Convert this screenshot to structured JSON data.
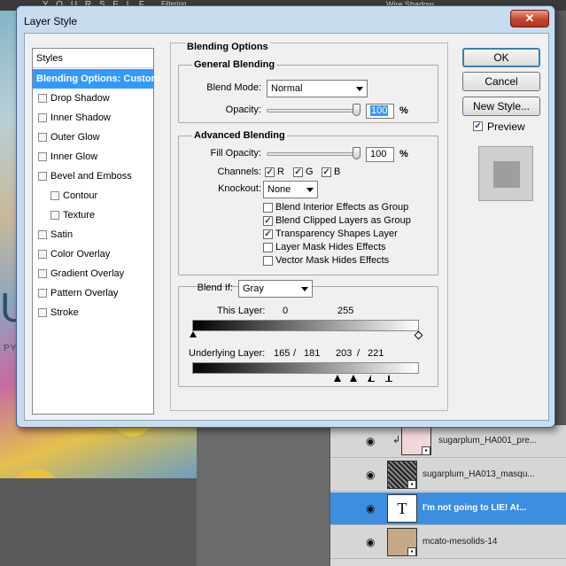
{
  "background": {
    "top_text": "Y O U R S E L F",
    "top_small": "Filtering ...",
    "panel_item": "Wire Shadow",
    "canvas_letter": "U",
    "canvas_caption": "PY"
  },
  "dialog": {
    "title": "Layer Style",
    "close_symbol": "✕",
    "styles_header": "Styles",
    "style_items": [
      {
        "label": "Blending Options: Custom",
        "checkbox": false,
        "selected": true
      },
      {
        "label": "Drop Shadow",
        "checkbox": true,
        "checked": false
      },
      {
        "label": "Inner Shadow",
        "checkbox": true,
        "checked": false
      },
      {
        "label": "Outer Glow",
        "checkbox": true,
        "checked": false
      },
      {
        "label": "Inner Glow",
        "checkbox": true,
        "checked": false
      },
      {
        "label": "Bevel and Emboss",
        "checkbox": true,
        "checked": false
      },
      {
        "label": "Contour",
        "checkbox": true,
        "checked": false,
        "indent": true
      },
      {
        "label": "Texture",
        "checkbox": true,
        "checked": false,
        "indent": true
      },
      {
        "label": "Satin",
        "checkbox": true,
        "checked": false
      },
      {
        "label": "Color Overlay",
        "checkbox": true,
        "checked": false
      },
      {
        "label": "Gradient Overlay",
        "checkbox": true,
        "checked": false
      },
      {
        "label": "Pattern Overlay",
        "checkbox": true,
        "checked": false
      },
      {
        "label": "Stroke",
        "checkbox": true,
        "checked": false
      }
    ],
    "blending": {
      "section_title": "Blending Options",
      "general_title": "General Blending",
      "blend_mode_label": "Blend Mode:",
      "blend_mode_value": "Normal",
      "opacity_label": "Opacity:",
      "opacity_value": "100",
      "opacity_fraction": 1.0,
      "percent": "%",
      "advanced_title": "Advanced Blending",
      "fill_opacity_label": "Fill Opacity:",
      "fill_opacity_value": "100",
      "fill_opacity_fraction": 1.0,
      "channels_label": "Channels:",
      "channel_r": "R",
      "channel_g": "G",
      "channel_b": "B",
      "knockout_label": "Knockout:",
      "knockout_value": "None",
      "options": [
        {
          "label": "Blend Interior Effects as Group",
          "checked": false
        },
        {
          "label": "Blend Clipped Layers as Group",
          "checked": true
        },
        {
          "label": "Transparency Shapes Layer",
          "checked": true
        },
        {
          "label": "Layer Mask Hides Effects",
          "checked": false
        },
        {
          "label": "Vector Mask Hides Effects",
          "checked": false
        }
      ],
      "blend_if_label": "Blend If:",
      "blend_if_value": "Gray",
      "this_layer_label": "This Layer:",
      "this_layer_low": "0",
      "this_layer_high": "255",
      "underlying_label": "Underlying Layer:",
      "underlying_a": "165",
      "underlying_sep1": "/",
      "underlying_b": "181",
      "underlying_c": "203",
      "underlying_sep2": "/",
      "underlying_d": "221"
    },
    "buttons": {
      "ok": "OK",
      "cancel": "Cancel",
      "new_style": "New Style...",
      "preview_label": "Preview",
      "preview_checked": true
    }
  },
  "layers": [
    {
      "name": "sugarplum_HA001_pre...",
      "clipped": true,
      "selected": false,
      "thumb_color": "#f3d6d8"
    },
    {
      "name": "sugarplum_HA013_masqu...",
      "clipped": false,
      "selected": false,
      "thumb_color": "#4a4a4a"
    },
    {
      "name": "I'm not going to LIE! At...",
      "clipped": false,
      "selected": true,
      "thumb_letter": "T"
    },
    {
      "name": "mcato-mesolids-14",
      "clipped": false,
      "selected": false,
      "thumb_color": "#c6a985"
    }
  ],
  "colors": {
    "accent": "#3399ff",
    "dialog_frame": "#c8dcef",
    "close_button": "#c5442b",
    "layer_selected": "#3d8ee0"
  }
}
